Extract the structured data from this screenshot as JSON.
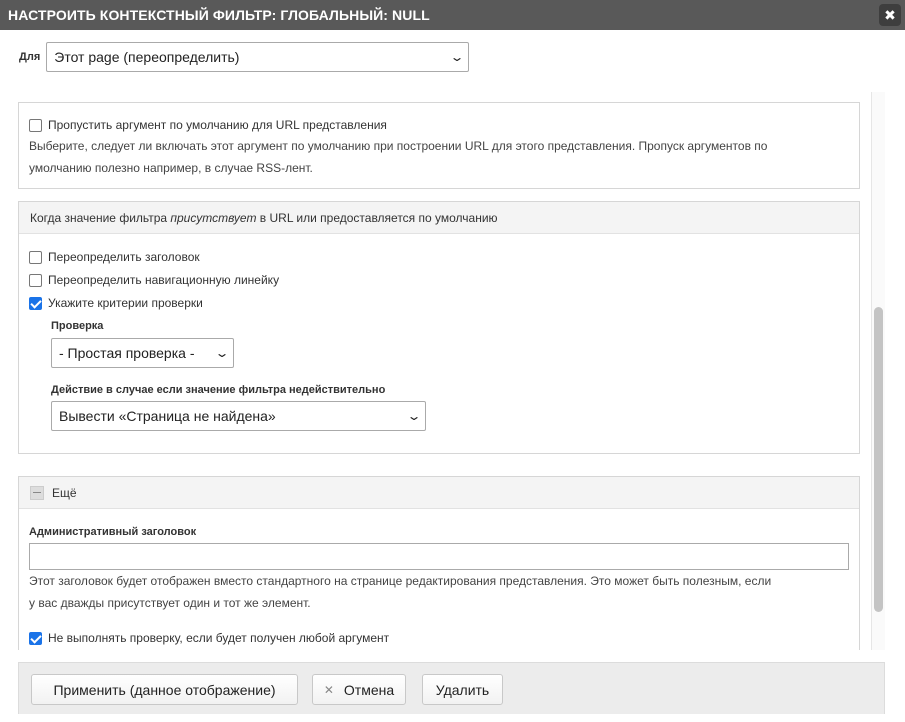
{
  "dialog": {
    "title": "НАСТРОИТЬ КОНТЕКСТНЫЙ ФИЛЬТР: ГЛОБАЛЬНЫЙ: NULL",
    "close_glyph": "✖"
  },
  "for_selector": {
    "label": "Для",
    "value": "Этот page (переопределить)"
  },
  "skip_default": {
    "checkbox_label": "Пропустить аргумент по умолчанию для URL представления",
    "checked": false,
    "description_line1": "Выберите, следует ли включать этот аргумент по умолчанию при построении URL для этого представления. Пропуск аргументов по",
    "description_line2": "умолчанию полезно например, в случае RSS-лент."
  },
  "when_present": {
    "header_before": "Когда значение фильтра ",
    "header_em": "присутствует",
    "header_after": " в URL или предоставляется по умолчанию",
    "override_title_label": "Переопределить заголовок",
    "override_title_checked": false,
    "override_breadcrumb_label": "Переопределить навигационную линейку",
    "override_breadcrumb_checked": false,
    "validation_criteria_label": "Укажите критерии проверки",
    "validation_criteria_checked": true,
    "validator_label": "Проверка",
    "validator_value": "- Простая проверка -",
    "invalid_action_label": "Действие в случае если значение фильтра недействительно",
    "invalid_action_value": "Вывести «Страница не найдена»"
  },
  "more": {
    "header_label": "Ещё",
    "admin_title_label": "Административный заголовок",
    "admin_title_value": "",
    "admin_title_desc_line1": "Этот заголовок будет отображен вместо стандартного на странице редактирования представления. Это может быть полезным, если",
    "admin_title_desc_line2": "у вас дважды присутствует один и тот же элемент.",
    "skip_validation_label": "Не выполнять проверку, если будет получен любой аргумент",
    "skip_validation_checked": true
  },
  "footer": {
    "apply_label": "Применить (данное отображение)",
    "cancel_label": "Отмена",
    "cancel_glyph": "✕",
    "delete_label": "Удалить"
  },
  "colors": {
    "titlebar": "#595959",
    "checkbox_checked": "#1a73e8",
    "panel_header": "#f4f4f4"
  }
}
